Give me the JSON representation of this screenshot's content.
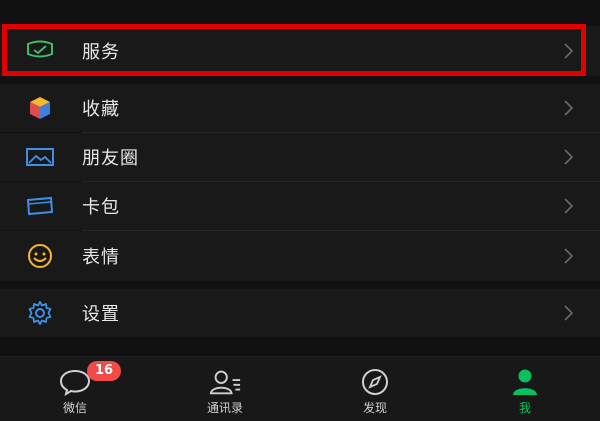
{
  "colors": {
    "background": "#111111",
    "row_bg": "#191919",
    "highlight": "#e00000",
    "accent_green": "#07c160",
    "badge": "#f24949"
  },
  "menu": [
    {
      "label": "服务",
      "icon": "wallet-service-icon",
      "highlighted": true
    },
    {
      "label": "收藏",
      "icon": "cube-favorites-icon"
    },
    {
      "label": "朋友圈",
      "icon": "moments-photo-icon"
    },
    {
      "label": "卡包",
      "icon": "card-wallet-icon"
    },
    {
      "label": "表情",
      "icon": "smiley-sticker-icon"
    },
    {
      "label": "设置",
      "icon": "gear-settings-icon"
    }
  ],
  "tabbar": {
    "tabs": [
      {
        "label": "微信",
        "icon": "chat-bubble-icon",
        "badge": "16"
      },
      {
        "label": "通讯录",
        "icon": "contacts-icon"
      },
      {
        "label": "发现",
        "icon": "compass-icon"
      },
      {
        "label": "我",
        "icon": "person-icon",
        "active": true
      }
    ]
  }
}
